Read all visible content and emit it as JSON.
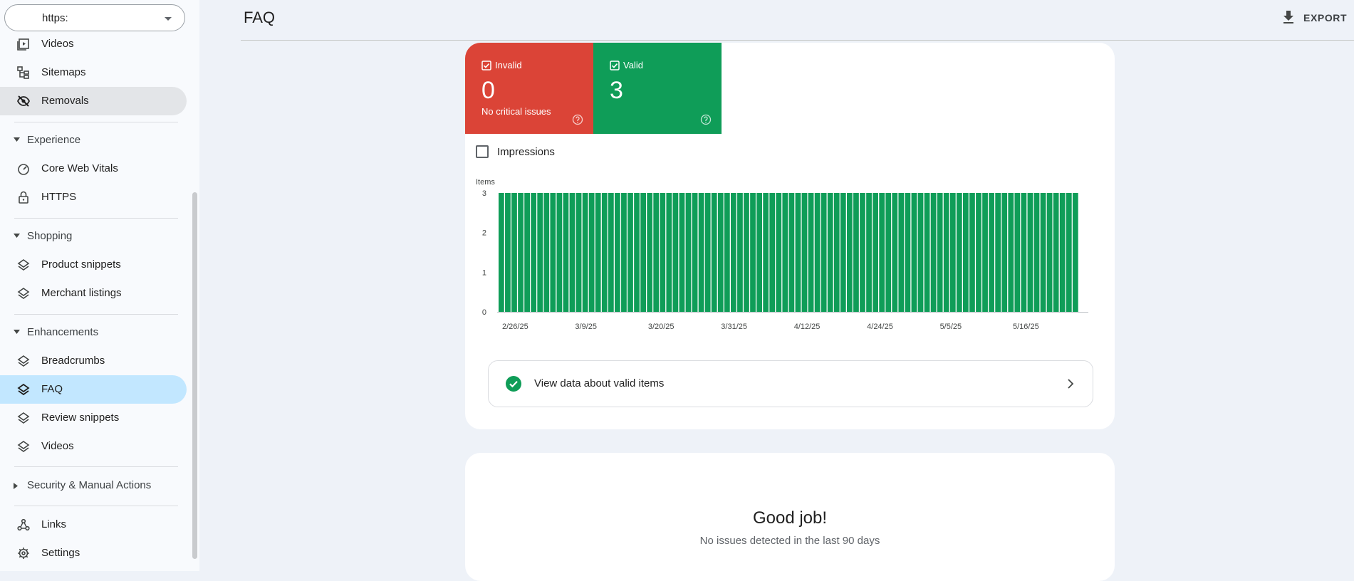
{
  "sidebar": {
    "property": "https:",
    "items": [
      {
        "label": "Videos",
        "icon": "video-icon"
      },
      {
        "label": "Sitemaps",
        "icon": "sitemap-icon"
      },
      {
        "label": "Removals",
        "icon": "eye-off-icon"
      },
      {
        "label": "Experience",
        "icon": "caret-down-icon"
      },
      {
        "label": "Core Web Vitals",
        "icon": "gauge-icon"
      },
      {
        "label": "HTTPS",
        "icon": "lock-icon"
      },
      {
        "label": "Shopping",
        "icon": "caret-down-icon"
      },
      {
        "label": "Product snippets",
        "icon": "layers-icon"
      },
      {
        "label": "Merchant listings",
        "icon": "layers-icon"
      },
      {
        "label": "Enhancements",
        "icon": "caret-down-icon"
      },
      {
        "label": "Breadcrumbs",
        "icon": "layers-icon"
      },
      {
        "label": "FAQ",
        "icon": "layers-icon"
      },
      {
        "label": "Review snippets",
        "icon": "layers-icon"
      },
      {
        "label": "Videos",
        "icon": "layers-icon"
      },
      {
        "label": "Security & Manual Actions",
        "icon": "caret-right-icon"
      },
      {
        "label": "Links",
        "icon": "links-icon"
      },
      {
        "label": "Settings",
        "icon": "gear-icon"
      }
    ]
  },
  "header": {
    "title": "FAQ",
    "export_label": "EXPORT"
  },
  "summary": {
    "invalid": {
      "label": "Invalid",
      "count": "0",
      "sub": "No critical issues",
      "color": "#db4437"
    },
    "valid": {
      "label": "Valid",
      "count": "3",
      "color": "#0f9d58"
    }
  },
  "impressions_label": "Impressions",
  "chart_data": {
    "type": "bar",
    "ylabel": "Items",
    "ylim": [
      0,
      3
    ],
    "yticks": [
      "0",
      "1",
      "2",
      "3"
    ],
    "xticks": [
      "2/26/25",
      "3/9/25",
      "3/20/25",
      "3/31/25",
      "4/12/25",
      "4/24/25",
      "5/5/25",
      "5/16/25"
    ],
    "series": [
      {
        "color": "#0f9d58",
        "values": [
          3,
          3,
          3,
          3,
          3,
          3,
          3,
          3,
          3,
          3,
          3,
          3,
          3,
          3,
          3,
          3,
          3,
          3,
          3,
          3,
          3,
          3,
          3,
          3,
          3,
          3,
          3,
          3,
          3,
          3,
          3,
          3,
          3,
          3,
          3,
          3,
          3,
          3,
          3,
          3,
          3,
          3,
          3,
          3,
          3,
          3,
          3,
          3,
          3,
          3,
          3,
          3,
          3,
          3,
          3,
          3,
          3,
          3,
          3,
          3,
          3,
          3,
          3,
          3,
          3,
          3,
          3,
          3,
          3,
          3,
          3,
          3,
          3,
          3,
          3,
          3,
          3,
          3,
          3,
          3,
          3,
          3,
          3,
          3,
          3,
          3,
          3,
          3,
          3,
          3
        ]
      }
    ]
  },
  "view_link": "View data about valid items",
  "status": {
    "title": "Good job!",
    "subtitle": "No issues detected in the last 90 days"
  }
}
